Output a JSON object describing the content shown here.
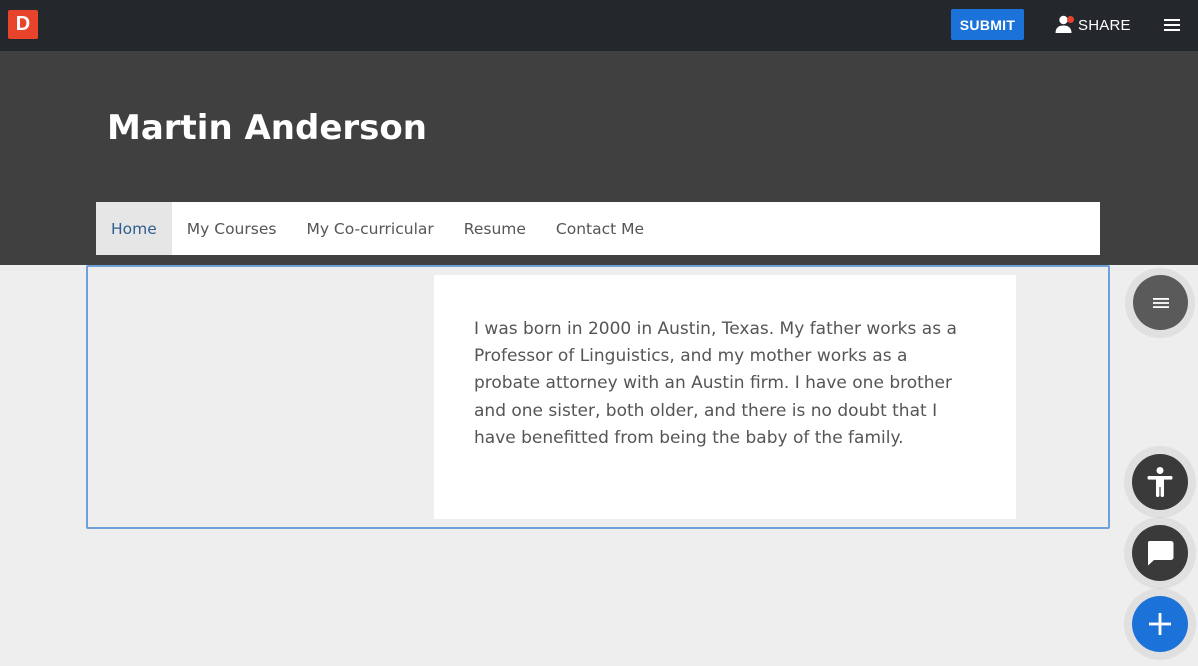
{
  "app": {
    "logo_letter": "D"
  },
  "topbar": {
    "submit_label": "SUBMIT",
    "share_label": "SHARE",
    "menu_icon": "hamburger-icon",
    "share_icon": "person-icon"
  },
  "profile": {
    "name": "Martin Anderson"
  },
  "nav": {
    "tabs": [
      {
        "label": "Home",
        "active": true
      },
      {
        "label": "My Courses",
        "active": false
      },
      {
        "label": "My Co-curricular",
        "active": false
      },
      {
        "label": "Resume",
        "active": false
      },
      {
        "label": "Contact Me",
        "active": false
      }
    ]
  },
  "content": {
    "bio": "I was born in 2000 in Austin, Texas. My father works as a Professor of Linguistics, and my mother works as a probate attorney with an Austin firm. I have one brother and one sister, both older, and there is no doubt that I have benefitted from being the baby of the family."
  },
  "floating_actions": {
    "section_menu_icon": "hamburger-icon",
    "accessibility_icon": "accessibility-icon",
    "chat_icon": "chat-bubble-icon",
    "add_icon": "plus-icon"
  },
  "colors": {
    "topbar_bg": "#24272b",
    "hero_bg": "#404040",
    "accent_blue": "#1b73d9",
    "logo_red": "#e8442b",
    "active_tab_text": "#2f5f8f",
    "section_outline": "#6fa0d8"
  }
}
